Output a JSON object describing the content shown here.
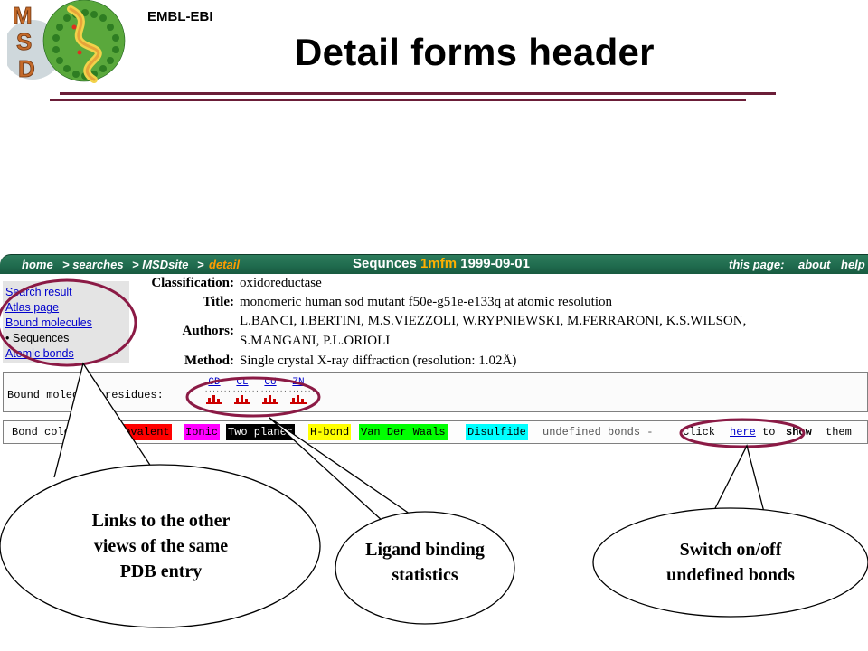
{
  "header": {
    "org": "EMBL-EBI",
    "title": "Detail forms header",
    "logo_letters": [
      "M",
      "S",
      "D"
    ]
  },
  "navbar": {
    "crumbs": [
      "home",
      "> searches",
      "> MSDsite",
      ">",
      "detail"
    ],
    "page_prefix": "Sequnces",
    "pdb_id": "1mfm",
    "date": "1999-09-01",
    "right_items": [
      "this page:",
      "about",
      "help"
    ]
  },
  "side_links": [
    {
      "label": "Search result",
      "link": true
    },
    {
      "label": "Atlas page",
      "link": true
    },
    {
      "label": "Bound molecules",
      "link": true
    },
    {
      "label": "Sequences",
      "link": false
    },
    {
      "label": "Atomic bonds",
      "link": true
    }
  ],
  "fields": [
    {
      "label": "Classification:",
      "value": "oxidoreductase"
    },
    {
      "label": "Title:",
      "value": "monomeric human sod mutant f50e-g51e-e133q at atomic resolution"
    },
    {
      "label": "Authors:",
      "value": "L.BANCI, I.BERTINI, M.S.VIEZZOLI, W.RYPNIEWSKI, M.FERRARONI, K.S.WILSON,"
    },
    {
      "label": "",
      "value": "S.MANGANI, P.L.ORIOLI"
    },
    {
      "label": "Method:",
      "value": "Single crystal X-ray diffraction (resolution: 1.02Å)"
    }
  ],
  "bound": {
    "label": "Bound molecule residues:",
    "residues": [
      "CD",
      "CL",
      "CU",
      "ZN"
    ]
  },
  "bonds": {
    "label": "Bond colour:",
    "types": [
      {
        "label": "Covalent",
        "bg": "#ff0000",
        "fg": "#000000"
      },
      {
        "label": "Ionic",
        "bg": "#ff00ff",
        "fg": "#000000"
      },
      {
        "label": "Two planes",
        "bg": "#000000",
        "fg": "#ffffff"
      },
      {
        "label": "H-bond",
        "bg": "#ffff00",
        "fg": "#000000"
      },
      {
        "label": "Van Der Waals",
        "bg": "#00ff00",
        "fg": "#000000"
      },
      {
        "label": "Disulfide",
        "bg": "#00ffff",
        "fg": "#000000"
      }
    ],
    "undefined_text": "undefined bonds -",
    "click_text": "Click",
    "here_link": "here",
    "to_text": "to",
    "show_text": "show",
    "them_text": "them"
  },
  "callouts": {
    "links": [
      "Links to the other",
      "views of the same",
      "PDB entry"
    ],
    "ligand": [
      "Ligand binding",
      "statistics"
    ],
    "switch": [
      "Switch on/off",
      "undefined bonds"
    ]
  },
  "colors": {
    "accent_rule": "#6b1e38",
    "annotation": "#8b1a45",
    "navbar": "#1f6a4d",
    "link": "#0000cc",
    "logo_green": "#3f9a33",
    "logo_letter": "#c46a2a"
  }
}
